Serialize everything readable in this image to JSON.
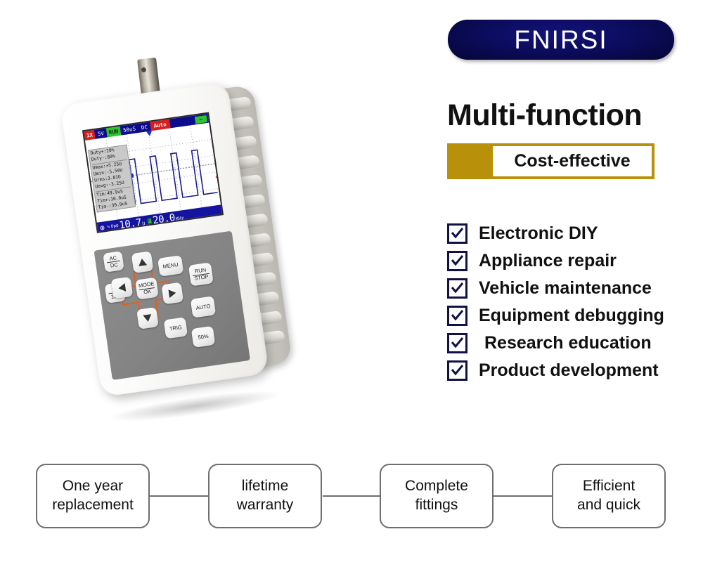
{
  "brand": {
    "name": "FNIRSI",
    "banner_color": "#0a0a50"
  },
  "headline": "Multi-function",
  "badge": {
    "label": "Cost-effective",
    "color": "#b8900a"
  },
  "checklist": {
    "check_color": "#111144",
    "items": [
      {
        "label": "Electronic DIY",
        "indent": false
      },
      {
        "label": "Appliance repair",
        "indent": false
      },
      {
        "label": "Vehicle maintenance",
        "indent": false
      },
      {
        "label": "Equipment debugging",
        "indent": false
      },
      {
        "label": "Research education",
        "indent": true
      },
      {
        "label": "Product development",
        "indent": false
      }
    ]
  },
  "features": [
    {
      "line1": "One year",
      "line2": "replacement"
    },
    {
      "line1": "lifetime",
      "line2": "warranty"
    },
    {
      "line1": "Complete",
      "line2": "fittings"
    },
    {
      "line1": "Efficient",
      "line2": "and quick"
    }
  ],
  "device": {
    "screen": {
      "topbar": {
        "probe": "1X",
        "volts_div": "5V",
        "run_state": "RUN",
        "time_div": "50uS",
        "coupling": "DC",
        "trigger_mode": "Auto",
        "battery_icon": "battery-icon"
      },
      "measurements": [
        "Duty+:20%",
        "Duty-:80%",
        "Umax:+5.25U",
        "Umin:-5.50U",
        "Urms:3.81U",
        "Uavg:-3.25U",
        "Tim:49.9uS",
        "Tim+:10.0uS",
        "Tim-:39.9uS"
      ],
      "bottombar": {
        "vpp_label": "Upp",
        "vpp_value": "10.7",
        "vpp_unit": "U",
        "freq_mark": "F",
        "freq_value": "20.0",
        "freq_unit": "KHz"
      }
    },
    "keys": {
      "ac_dc_top": "AC",
      "ac_dc_bottom": "DC",
      "x_top": "1X",
      "x_bottom": "10X",
      "mode_top": "MODE",
      "mode_bottom": "OK",
      "menu": "MENU",
      "run_top": "RUN",
      "run_bottom": "STOP",
      "auto": "AUTO",
      "trig": "TRIG",
      "fifty": "50%",
      "up": "up-arrow-icon",
      "down": "down-arrow-icon",
      "left": "left-arrow-icon",
      "right": "right-arrow-icon"
    }
  }
}
